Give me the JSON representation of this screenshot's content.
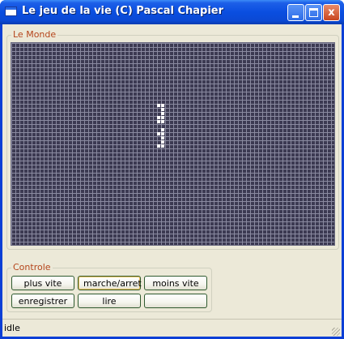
{
  "window": {
    "title": "Le jeu de la vie (C) Pascal Chapier",
    "minimize_label": "",
    "maximize_label": "",
    "close_label": "x"
  },
  "world": {
    "group_title": "Le Monde",
    "cols": 80,
    "rows": 50,
    "live_cells": [
      [
        36,
        15
      ],
      [
        37,
        15
      ],
      [
        37,
        16
      ],
      [
        37,
        17
      ],
      [
        36,
        18
      ],
      [
        37,
        18
      ],
      [
        36,
        19
      ],
      [
        37,
        19
      ],
      [
        37,
        21
      ],
      [
        36,
        22
      ],
      [
        37,
        22
      ],
      [
        37,
        23
      ],
      [
        37,
        24
      ],
      [
        36,
        25
      ],
      [
        37,
        25
      ]
    ]
  },
  "controls": {
    "group_title": "Controle",
    "buttons": [
      {
        "label": "plus vite"
      },
      {
        "label": "marche/arret"
      },
      {
        "label": "moins vite"
      },
      {
        "label": "enregistrer"
      },
      {
        "label": "lire"
      },
      {
        "label": ""
      }
    ]
  },
  "status": {
    "text": "idle"
  }
}
